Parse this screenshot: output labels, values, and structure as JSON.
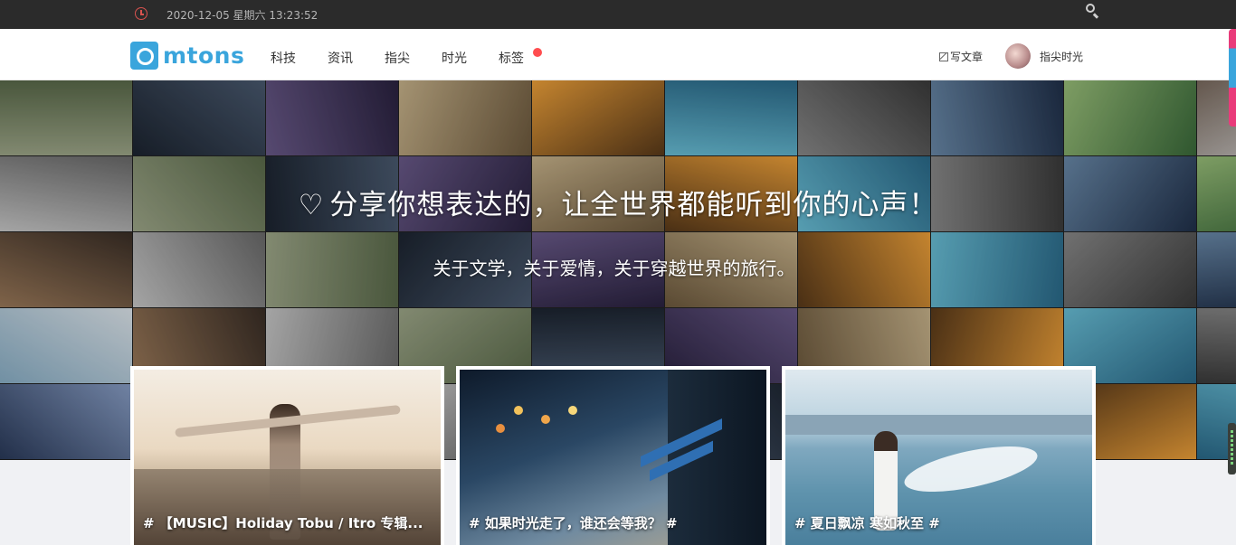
{
  "topbar": {
    "datetime": "2020-12-05 星期六 13:23:52",
    "clock_icon": "clock-icon",
    "search_icon": "search-icon"
  },
  "nav": {
    "logo_text": "mtons",
    "items": [
      {
        "label": "科技"
      },
      {
        "label": "资讯"
      },
      {
        "label": "指尖"
      },
      {
        "label": "时光"
      },
      {
        "label": "标签"
      }
    ],
    "write_label": "写文章",
    "username": "指尖时光",
    "accent_color": "#3aa5dc",
    "badge_color": "#ff4d4f"
  },
  "hero": {
    "title": "分享你想表达的，让全世界都能听到你的心声！",
    "subtitle": "关于文学，关于爱情，关于穿越世界的旅行。",
    "heart_icon": "heart-icon"
  },
  "cards": [
    {
      "caption": "# 【MUSIC】Holiday Tobu / Itro 专辑..."
    },
    {
      "caption": "# 如果时光走了，谁还会等我？ #"
    },
    {
      "caption": "# 夏日飘凉 寒如秋至 #"
    }
  ]
}
